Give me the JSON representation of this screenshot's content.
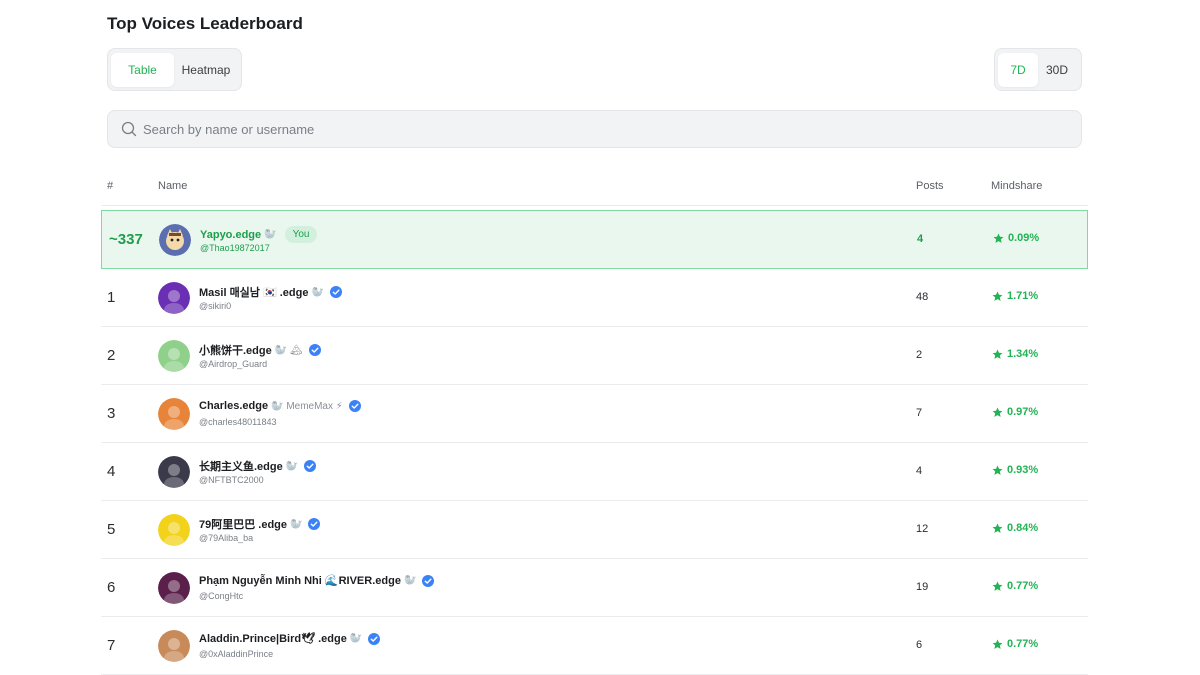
{
  "page": {
    "title": "Top Voices Leaderboard"
  },
  "view_toggle": {
    "table": "Table",
    "heatmap": "Heatmap",
    "active": "Table"
  },
  "range_toggle": {
    "d7": "7D",
    "d30": "30D",
    "active": "7D"
  },
  "search": {
    "placeholder": "Search by name or username",
    "value": ""
  },
  "table": {
    "headers": {
      "rank": "#",
      "name": "Name",
      "posts": "Posts",
      "mindshare": "Mindshare"
    },
    "current_user": {
      "rank": "~337",
      "name": "Yapyo.edge",
      "emoji": "🦭",
      "badge": "You",
      "handle": "@Thao19872017",
      "posts": "4",
      "mindshare": "0.09%"
    },
    "rows": [
      {
        "rank": "1",
        "name": "Masil 매실남 🇰🇷 .edge",
        "emoji": "🦭",
        "handle": "@sikiri0",
        "posts": "48",
        "mindshare": "1.71%",
        "verified": true,
        "avatar_color": "#6a2fb3"
      },
      {
        "rank": "2",
        "name": "小熊饼干.edge",
        "emoji": "🦭 🏔",
        "handle": "@Airdrop_Guard",
        "posts": "2",
        "mindshare": "1.34%",
        "verified": true,
        "avatar_color": "#8fd18a"
      },
      {
        "rank": "3",
        "name": "Charles.edge",
        "emoji": "🦭 MemeMax ⚡",
        "handle": "@charles48011843",
        "posts": "7",
        "mindshare": "0.97%",
        "verified": true,
        "avatar_color": "#e8843a"
      },
      {
        "rank": "4",
        "name": "长期主义鱼.edge",
        "emoji": "🦭",
        "handle": "@NFTBTC2000",
        "posts": "4",
        "mindshare": "0.93%",
        "verified": true,
        "avatar_color": "#3a3a4a"
      },
      {
        "rank": "5",
        "name": "79阿里巴巴 .edge",
        "emoji": "🦭",
        "handle": "@79Aliba_ba",
        "posts": "12",
        "mindshare": "0.84%",
        "verified": true,
        "avatar_color": "#f2d21b"
      },
      {
        "rank": "6",
        "name": "Phạm Nguyễn Minh Nhi 🌊RIVER.edge",
        "emoji": "🦭",
        "handle": "@CongHtc",
        "posts": "19",
        "mindshare": "0.77%",
        "verified": true,
        "avatar_color": "#5a1f4a"
      },
      {
        "rank": "7",
        "name": "Aladdin.Prince|Bird🕊 .edge",
        "emoji": "🦭",
        "handle": "@0xAladdinPrince",
        "posts": "6",
        "mindshare": "0.77%",
        "verified": true,
        "avatar_color": "#c98a5a"
      }
    ]
  },
  "colors": {
    "accent": "#22b355",
    "highlight_bg": "#e9f7ee",
    "verified": "#3b82f6"
  },
  "icons": {
    "search": "search-icon",
    "verified": "verified-check-icon",
    "mindshare": "star-icon"
  }
}
